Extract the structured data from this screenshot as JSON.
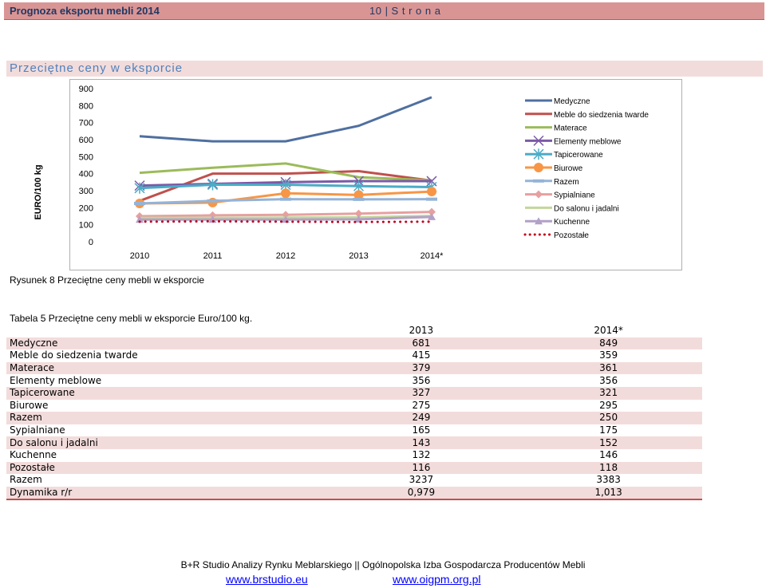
{
  "header": {
    "title": "Prognoza eksportu mebli 2014",
    "page": "10 | S t r o n a"
  },
  "section_title": "Przeciętne ceny w eksporcie",
  "figure_caption": "Rysunek 8 Przeciętne ceny mebli w eksporcie",
  "table_caption": "Tabela 5 Przeciętne ceny mebli w eksporcie Euro/100 kg.",
  "chart_data": {
    "type": "line",
    "ylabel": "EURO/100 kg",
    "xlabel": "",
    "categories": [
      "2010",
      "2011",
      "2012",
      "2013",
      "2014*"
    ],
    "ylim": [
      0,
      900
    ],
    "yticks": [
      "0",
      "100",
      "200",
      "300",
      "400",
      "500",
      "600",
      "700",
      "800",
      "900"
    ],
    "legend_position": "right",
    "grid": false,
    "series": [
      {
        "name": "Medyczne",
        "color": "#4f6fa0",
        "marker": "none",
        "values": [
          620,
          590,
          590,
          681,
          849
        ]
      },
      {
        "name": "Meble do siedzenia twarde",
        "color": "#c0504d",
        "marker": "none",
        "values": [
          240,
          400,
          400,
          415,
          359
        ]
      },
      {
        "name": "Materace",
        "color": "#9bbb59",
        "marker": "none",
        "values": [
          405,
          435,
          460,
          379,
          361
        ]
      },
      {
        "name": "Elementy meblowe",
        "color": "#7b5aa6",
        "marker": "x",
        "values": [
          330,
          340,
          350,
          356,
          356
        ]
      },
      {
        "name": "Tapicerowane",
        "color": "#4bacc6",
        "marker": "star",
        "values": [
          315,
          335,
          335,
          327,
          321
        ]
      },
      {
        "name": "Biurowe",
        "color": "#f79646",
        "marker": "circle",
        "values": [
          225,
          230,
          285,
          275,
          295
        ]
      },
      {
        "name": "Razem",
        "color": "#95b3d7",
        "marker": "dash",
        "values": [
          225,
          240,
          250,
          249,
          250
        ]
      },
      {
        "name": "Sypialniane",
        "color": "#e6a0a0",
        "marker": "diamond",
        "values": [
          150,
          155,
          158,
          165,
          175
        ]
      },
      {
        "name": "Do salonu i jadalni",
        "color": "#c3d69b",
        "marker": "none",
        "values": [
          140,
          140,
          142,
          143,
          152
        ]
      },
      {
        "name": "Kuchenne",
        "color": "#b2a1c7",
        "marker": "triangle",
        "values": [
          130,
          130,
          130,
          132,
          146
        ]
      },
      {
        "name": "Pozostałe",
        "color": "#c0001a",
        "marker": "dots",
        "values": [
          118,
          120,
          118,
          116,
          118
        ]
      }
    ]
  },
  "table": {
    "columns": [
      "",
      "2013",
      "2014*"
    ],
    "rows": [
      [
        "Medyczne",
        "681",
        "849"
      ],
      [
        "Meble do siedzenia twarde",
        "415",
        "359"
      ],
      [
        "Materace",
        "379",
        "361"
      ],
      [
        "Elementy meblowe",
        "356",
        "356"
      ],
      [
        "Tapicerowane",
        "327",
        "321"
      ],
      [
        "Biurowe",
        "275",
        "295"
      ],
      [
        "Razem",
        "249",
        "250"
      ],
      [
        "Sypialniane",
        "165",
        "175"
      ],
      [
        "Do salonu i jadalni",
        "143",
        "152"
      ],
      [
        "Kuchenne",
        "132",
        "146"
      ],
      [
        "Pozostałe",
        "116",
        "118"
      ],
      [
        "Razem",
        "3237",
        "3383"
      ],
      [
        "Dynamika r/r",
        "0,979",
        "1,013"
      ]
    ]
  },
  "footer": {
    "text": "B+R Studio Analizy Rynku Meblarskiego  ||  Ogólnopolska Izba Gospodarcza Producentów Mebli",
    "link1": "www.brstudio.eu",
    "link2": "www.oigpm.org.pl"
  }
}
